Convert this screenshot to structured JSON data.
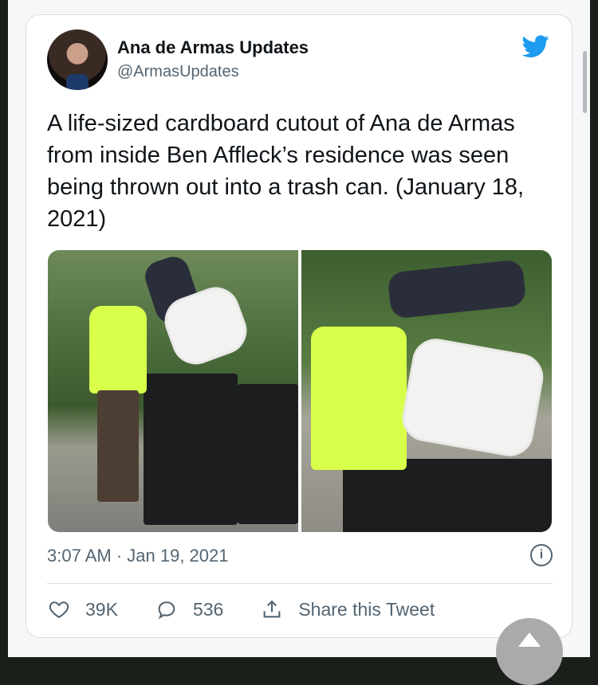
{
  "tweet": {
    "author_name": "Ana de Armas Updates",
    "author_handle": "@ArmasUpdates",
    "text": "A life-sized cardboard cutout of Ana de Armas from inside Ben Affleck’s residence was seen being thrown out into a trash can. (January 18, 2021)",
    "timestamp": "3:07 AM · Jan 19, 2021"
  },
  "actions": {
    "likes": "39K",
    "replies": "536",
    "share_label": "Share this Tweet"
  },
  "colors": {
    "twitter_blue": "#1d9bf0",
    "text_primary": "#0f1419",
    "text_secondary": "#536471"
  },
  "icons": [
    "twitter-bird-icon",
    "info-icon",
    "heart-icon",
    "reply-icon",
    "share-icon",
    "scroll-up-icon"
  ]
}
